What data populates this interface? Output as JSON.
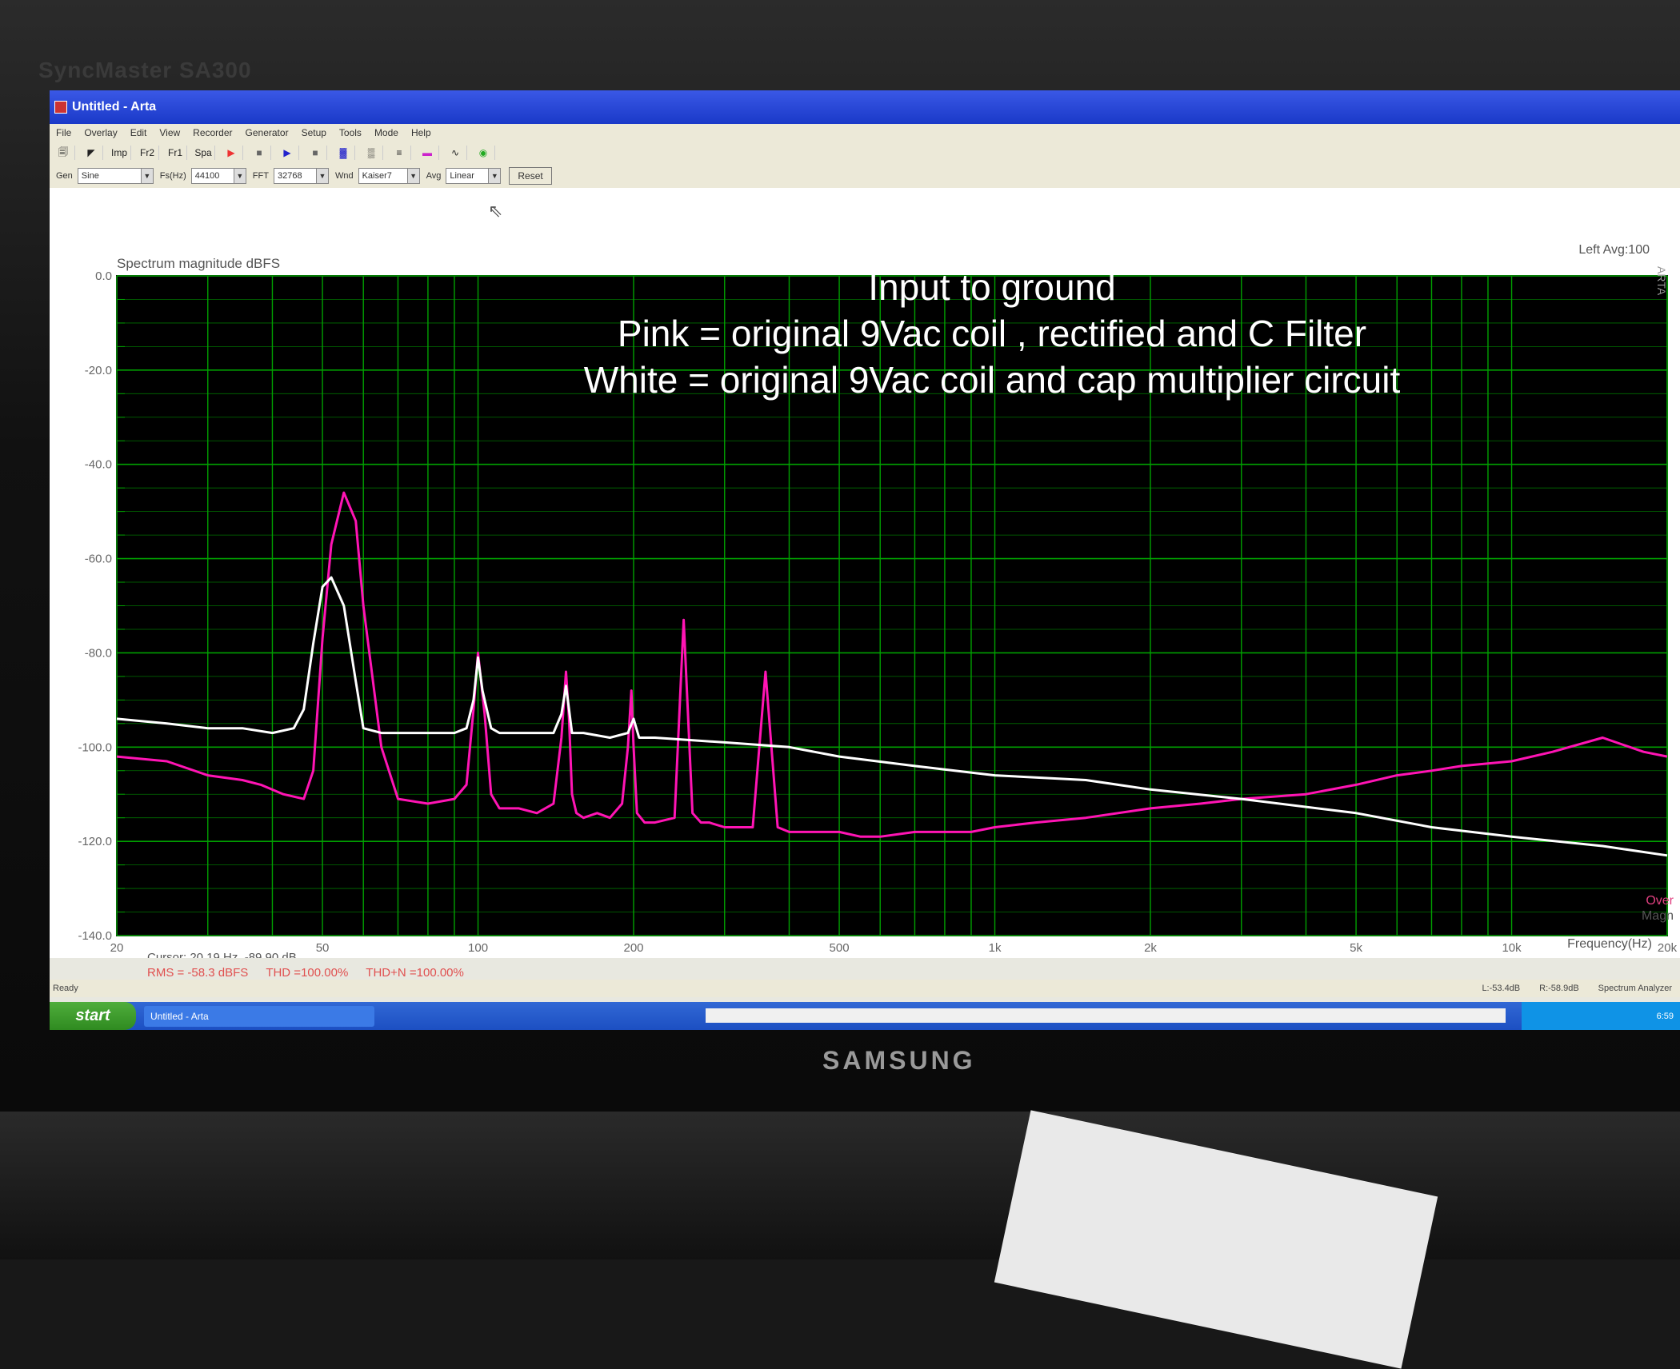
{
  "monitor": {
    "model": "SyncMaster SA300",
    "brand": "SAMSUNG"
  },
  "window": {
    "title": "Untitled - Arta"
  },
  "menu": [
    "File",
    "Overlay",
    "Edit",
    "View",
    "Recorder",
    "Generator",
    "Setup",
    "Tools",
    "Mode",
    "Help"
  ],
  "toolbar": {
    "buttons": [
      "Imp",
      "Fr2",
      "Fr1",
      "Spa"
    ]
  },
  "settings": {
    "gen_label": "Gen",
    "gen_value": "Sine",
    "fs_label": "Fs(Hz)",
    "fs_value": "44100",
    "fft_label": "FFT",
    "fft_value": "32768",
    "wnd_label": "Wnd",
    "wnd_value": "Kaiser7",
    "avg_label": "Avg",
    "avg_value": "Linear",
    "reset_label": "Reset"
  },
  "status": {
    "ready": "Ready",
    "left": "L:-53.4dB",
    "right": "R:-58.9dB",
    "mode": "Spectrum Analyzer"
  },
  "taskbar": {
    "start": "start",
    "task": "Untitled - Arta",
    "time": "6:59"
  },
  "colors": {
    "pink": "#ff14b4",
    "white": "#ffffff",
    "grid": "#00a000",
    "plot_bg": "#000000"
  },
  "chart_data": {
    "type": "line",
    "title": "Input to ground",
    "annotation_lines": [
      "Pink = original 9Vac coil , rectified and C Filter",
      "White = original 9Vac coil and cap multiplier circuit"
    ],
    "ylabel": "Spectrum magnitude dBFS",
    "xlabel": "Frequency(Hz)",
    "top_right": "Left  Avg:100",
    "side_label": "ARTA",
    "over_label": "Over",
    "magn_label": "Magn",
    "xscale": "log",
    "xlim": [
      20,
      20000
    ],
    "ylim": [
      -140,
      0
    ],
    "yticks": [
      "0.0",
      "-20.0",
      "-40.0",
      "-60.0",
      "-80.0",
      "-100.0",
      "-120.0",
      "-140.0"
    ],
    "xticks": [
      {
        "v": 20,
        "l": "20"
      },
      {
        "v": 50,
        "l": "50"
      },
      {
        "v": 100,
        "l": "100"
      },
      {
        "v": 200,
        "l": "200"
      },
      {
        "v": 500,
        "l": "500"
      },
      {
        "v": 1000,
        "l": "1k"
      },
      {
        "v": 2000,
        "l": "2k"
      },
      {
        "v": 5000,
        "l": "5k"
      },
      {
        "v": 10000,
        "l": "10k"
      },
      {
        "v": 20000,
        "l": "20k"
      }
    ],
    "cursor_text": "Cursor: 20.19 Hz, -89.90 dB",
    "rms_text": "RMS = -58.3 dBFS",
    "thd_text": "THD =100.00%",
    "thdn_text": "THD+N =100.00%",
    "series": [
      {
        "color": "pink",
        "x": [
          20,
          25,
          30,
          35,
          38,
          42,
          46,
          48,
          50,
          52,
          55,
          58,
          60,
          65,
          70,
          80,
          90,
          95,
          98,
          100,
          103,
          106,
          110,
          120,
          130,
          140,
          145,
          148,
          150,
          152,
          155,
          160,
          170,
          180,
          190,
          195,
          198,
          200,
          203,
          210,
          220,
          240,
          250,
          260,
          270,
          280,
          300,
          320,
          340,
          360,
          380,
          400,
          430,
          460,
          500,
          550,
          600,
          700,
          800,
          900,
          1000,
          1200,
          1500,
          2000,
          2500,
          3000,
          4000,
          5000,
          6000,
          7000,
          8000,
          10000,
          12000,
          15000,
          18000,
          20000
        ],
        "y": [
          -102,
          -103,
          -106,
          -107,
          -108,
          -110,
          -111,
          -105,
          -77,
          -57,
          -46,
          -52,
          -70,
          -100,
          -111,
          -112,
          -111,
          -108,
          -92,
          -80,
          -93,
          -110,
          -113,
          -113,
          -114,
          -112,
          -98,
          -84,
          -94,
          -110,
          -114,
          -115,
          -114,
          -115,
          -112,
          -100,
          -88,
          -100,
          -114,
          -116,
          -116,
          -115,
          -73,
          -114,
          -116,
          -116,
          -117,
          -117,
          -117,
          -84,
          -117,
          -118,
          -118,
          -118,
          -118,
          -119,
          -119,
          -118,
          -118,
          -118,
          -117,
          -116,
          -115,
          -113,
          -112,
          -111,
          -110,
          -108,
          -106,
          -105,
          -104,
          -103,
          -101,
          -98,
          -101,
          -102
        ]
      },
      {
        "color": "white",
        "x": [
          20,
          25,
          30,
          35,
          40,
          44,
          46,
          48,
          50,
          52,
          55,
          58,
          60,
          65,
          70,
          80,
          90,
          95,
          98,
          100,
          102,
          106,
          110,
          120,
          140,
          145,
          148,
          150,
          152,
          160,
          180,
          195,
          200,
          205,
          220,
          300,
          400,
          500,
          700,
          1000,
          1500,
          2000,
          3000,
          5000,
          7000,
          10000,
          15000,
          20000
        ],
        "y": [
          -94,
          -95,
          -96,
          -96,
          -97,
          -96,
          -92,
          -78,
          -66,
          -64,
          -70,
          -86,
          -96,
          -97,
          -97,
          -97,
          -97,
          -96,
          -90,
          -81,
          -88,
          -96,
          -97,
          -97,
          -97,
          -93,
          -87,
          -92,
          -97,
          -97,
          -98,
          -97,
          -94,
          -98,
          -98,
          -99,
          -100,
          -102,
          -104,
          -106,
          -107,
          -109,
          -111,
          -114,
          -117,
          -119,
          -121,
          -123
        ]
      }
    ]
  }
}
